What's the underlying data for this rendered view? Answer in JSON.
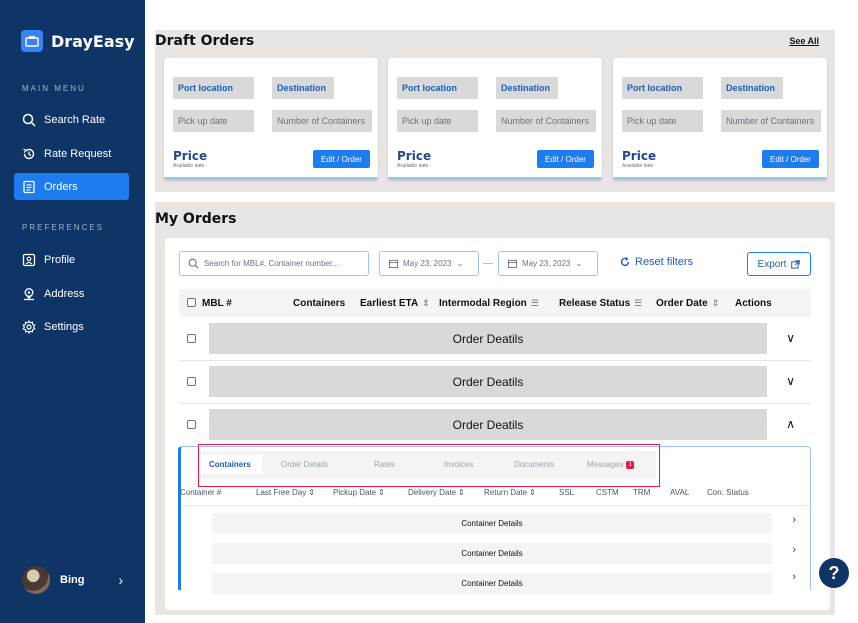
{
  "brand": {
    "name": "DrayEasy"
  },
  "sidebar": {
    "main_menu_label": "MAIN MENU",
    "main_items": [
      {
        "label": "Search Rate",
        "icon": "search-icon"
      },
      {
        "label": "Rate Request",
        "icon": "history-icon"
      },
      {
        "label": "Orders",
        "icon": "document-icon"
      }
    ],
    "preferences_label": "PREFERENCES",
    "pref_items": [
      {
        "label": "Profile",
        "icon": "id-card-icon"
      },
      {
        "label": "Address",
        "icon": "location-icon"
      },
      {
        "label": "Settings",
        "icon": "gear-icon"
      }
    ],
    "user": {
      "name": "Bing"
    }
  },
  "draft": {
    "title": "Draft Orders",
    "see_all": "See All",
    "cards": [
      {
        "port": "Port location",
        "destination": "Destination",
        "pickup": "Pick up date",
        "containers": "Number of Containers",
        "price": "Price",
        "price_sub": "Available date",
        "action": "Edit / Order"
      },
      {
        "port": "Port location",
        "destination": "Destination",
        "pickup": "Pick up date",
        "containers": "Number of Containers",
        "price": "Price",
        "price_sub": "Available date",
        "action": "Edit / Order"
      },
      {
        "port": "Port location",
        "destination": "Destination",
        "pickup": "Pick up date",
        "containers": "Number of Containers",
        "price": "Price",
        "price_sub": "Available date",
        "action": "Edit / Order"
      }
    ]
  },
  "orders": {
    "title": "My Orders",
    "search_placeholder": "Search for MBL#, Container number...",
    "date_from": "May 23, 2023",
    "date_to": "May 23, 2023",
    "dash": "—",
    "reset": "Reset filters",
    "export": "Export",
    "columns": {
      "mbl": "MBL #",
      "containers": "Containers",
      "eta": "Earliest ETA",
      "region": "Intermodal Region",
      "release": "Release Status",
      "order_date": "Order Date",
      "actions": "Actions"
    },
    "rows": [
      {
        "label": "Order Deatils"
      },
      {
        "label": "Order Deatils"
      },
      {
        "label": "Order Deatils"
      }
    ],
    "detail": {
      "tabs": [
        "Containers",
        "Order Details",
        "Rates",
        "Invoices",
        "Documents",
        "Messages"
      ],
      "message_count": "1",
      "columns": [
        "Container #",
        "Last Free Day",
        "Pickup Date",
        "Delivery Date",
        "Return Date",
        "SSL",
        "CSTM",
        "TRM",
        "AVAL",
        "Con. Status"
      ],
      "rows": [
        {
          "label": "Container Details"
        },
        {
          "label": "Container Details"
        },
        {
          "label": "Container Details"
        }
      ]
    }
  },
  "help": {
    "label": "?"
  },
  "colors": {
    "sidebar": "#0f3567",
    "accent": "#1e7bf0",
    "panel": "#e8e5e3",
    "badge": "#e11d48"
  }
}
